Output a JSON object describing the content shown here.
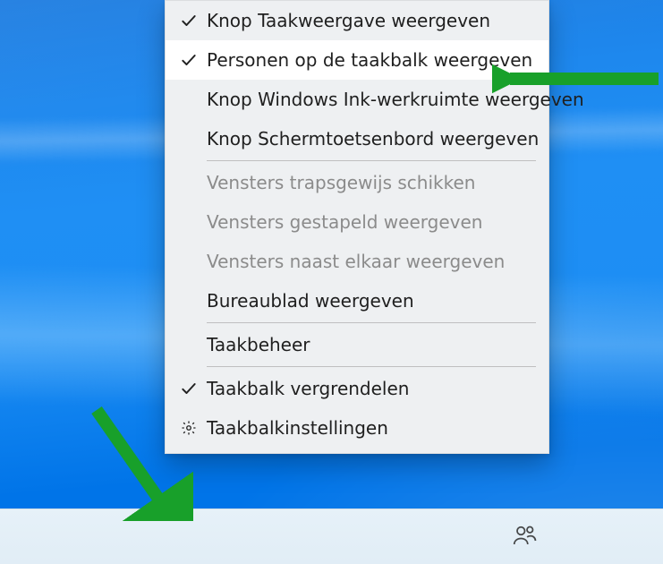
{
  "menu": {
    "items": [
      {
        "label": "Knop Taakweergave weergeven",
        "checked": true,
        "enabled": true,
        "icon": "checkmark-icon",
        "highlight": false
      },
      {
        "label": "Personen op de taakbalk weergeven",
        "checked": true,
        "enabled": true,
        "icon": "checkmark-icon",
        "highlight": true
      },
      {
        "label": "Knop Windows Ink-werkruimte weergeven",
        "checked": false,
        "enabled": true,
        "icon": null,
        "highlight": false
      },
      {
        "label": "Knop Schermtoetsenbord weergeven",
        "checked": false,
        "enabled": true,
        "icon": null,
        "highlight": false
      },
      {
        "separator": true
      },
      {
        "label": "Vensters trapsgewijs schikken",
        "checked": false,
        "enabled": false,
        "icon": null,
        "highlight": false
      },
      {
        "label": "Vensters gestapeld weergeven",
        "checked": false,
        "enabled": false,
        "icon": null,
        "highlight": false
      },
      {
        "label": "Vensters naast elkaar weergeven",
        "checked": false,
        "enabled": false,
        "icon": null,
        "highlight": false
      },
      {
        "label": "Bureaublad weergeven",
        "checked": false,
        "enabled": true,
        "icon": null,
        "highlight": false
      },
      {
        "separator": true
      },
      {
        "label": "Taakbeheer",
        "checked": false,
        "enabled": true,
        "icon": null,
        "highlight": false
      },
      {
        "separator": true
      },
      {
        "label": "Taakbalk vergrendelen",
        "checked": true,
        "enabled": true,
        "icon": "checkmark-icon",
        "highlight": false
      },
      {
        "label": "Taakbalkinstellingen",
        "checked": false,
        "enabled": true,
        "icon": "gear-icon",
        "highlight": false
      }
    ]
  },
  "annotations": {
    "arrow_right_color": "#18a02a",
    "arrow_bottom_color": "#18a02a"
  },
  "taskbar": {
    "people_icon": "people-icon"
  }
}
